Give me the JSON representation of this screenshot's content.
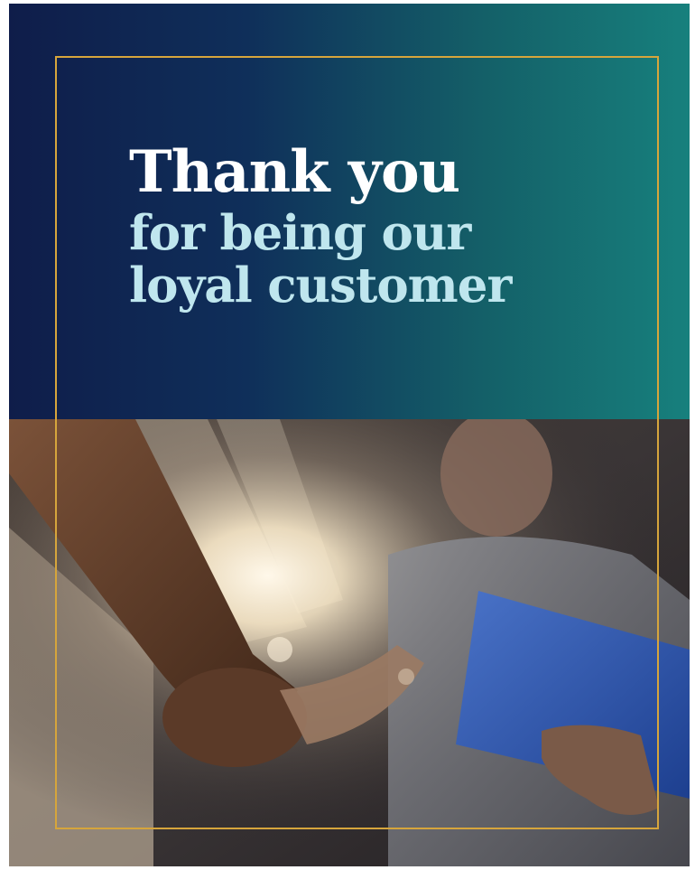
{
  "card": {
    "headline_line1": "Thank you",
    "headline_line2": "for being our",
    "headline_line3": "loyal customer"
  },
  "colors": {
    "gradient_start": "#0f1d4a",
    "gradient_end": "#17807d",
    "headline_primary": "#ffffff",
    "headline_secondary": "#bfe6ee",
    "frame_border": "#d6a53c"
  }
}
